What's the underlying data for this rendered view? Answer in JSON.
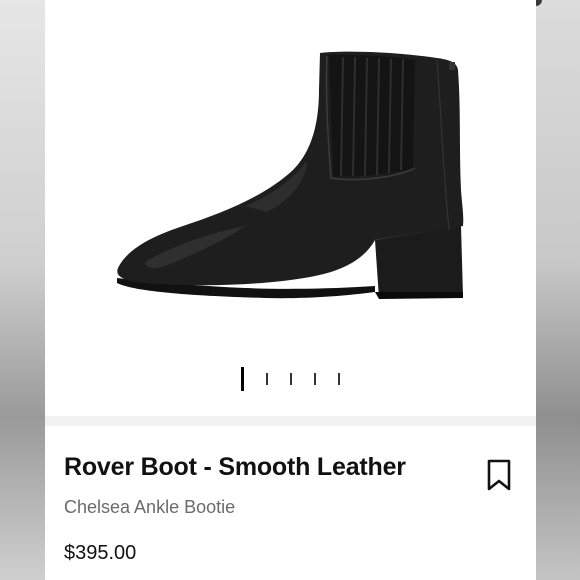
{
  "product": {
    "title": "Rover Boot - Smooth Leather",
    "subtitle": "Chelsea Ankle Bootie",
    "price": "$395.00"
  },
  "gallery": {
    "image_subject": "black-chelsea-ankle-boot",
    "page_count": 5,
    "current_page": 1
  },
  "icons": {
    "save": "bookmark-icon"
  },
  "colors": {
    "background": "#ffffff",
    "text_primary": "#111111",
    "text_secondary": "#6b6b6b"
  }
}
